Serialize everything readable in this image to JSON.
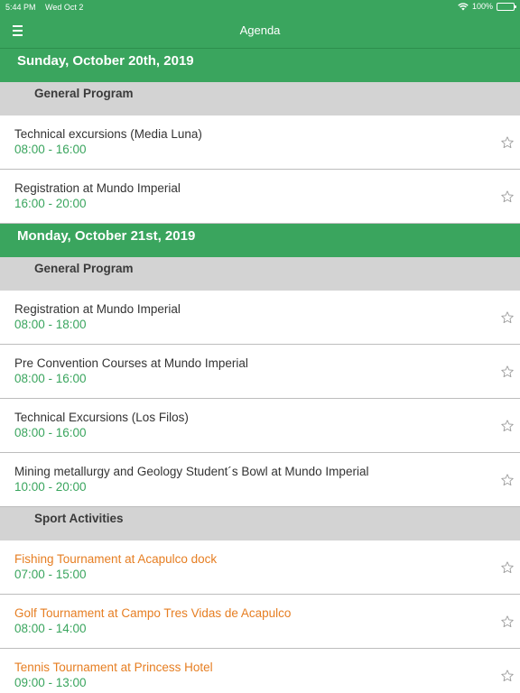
{
  "status": {
    "time": "5:44 PM",
    "date": "Wed Oct 2",
    "battery": "100%"
  },
  "nav": {
    "title": "Agenda"
  },
  "days": [
    {
      "label": "Sunday, October 20th, 2019",
      "groups": [
        {
          "label": "General Program",
          "events": [
            {
              "title": "Technical excursions (Media Luna)",
              "time": "08:00 - 16:00"
            },
            {
              "title": "Registration at Mundo Imperial",
              "time": "16:00 - 20:00"
            }
          ]
        }
      ]
    },
    {
      "label": "Monday, October 21st, 2019",
      "groups": [
        {
          "label": "General Program",
          "events": [
            {
              "title": "Registration at Mundo Imperial",
              "time": "08:00 - 18:00"
            },
            {
              "title": "Pre Convention Courses at Mundo Imperial",
              "time": "08:00 - 16:00"
            },
            {
              "title": "Technical Excursions (Los Filos)",
              "time": "08:00 - 16:00"
            },
            {
              "title": "Mining metallurgy and Geology Student´s Bowl at Mundo Imperial",
              "time": "10:00 - 20:00"
            }
          ]
        },
        {
          "label": "Sport Activities",
          "events": [
            {
              "title": "Fishing Tournament at Acapulco dock",
              "time": "07:00 - 15:00"
            },
            {
              "title": "Golf Tournament at Campo Tres Vidas de Acapulco",
              "time": "08:00 - 14:00"
            },
            {
              "title": "Tennis Tournament at Princess Hotel",
              "time": "09:00 - 13:00"
            }
          ]
        }
      ]
    }
  ],
  "colors": {
    "primary": "#3aa55e",
    "sport": "#e67e22",
    "group_bg": "#d3d3d3"
  },
  "icons": {
    "menu": "hamburger-icon",
    "favorite": "star-outline-icon",
    "wifi": "wifi-icon",
    "battery": "battery-icon"
  }
}
